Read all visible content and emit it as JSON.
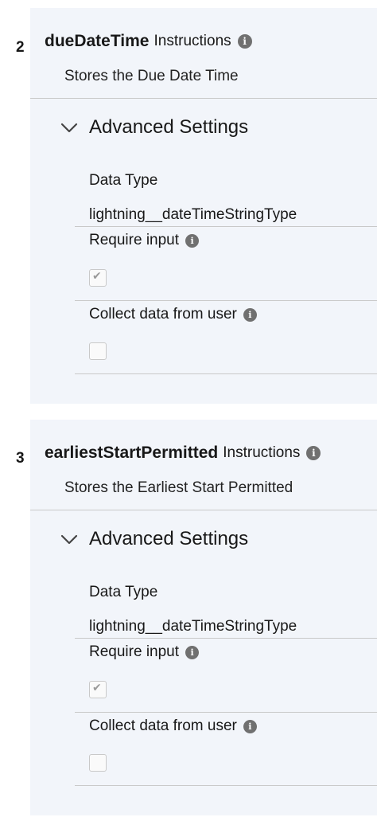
{
  "variables": [
    {
      "number": "2",
      "name": "dueDateTime",
      "instructions_label": "Instructions",
      "description": "Stores the Due Date Time",
      "advanced_label": "Advanced Settings",
      "data_type_label": "Data Type",
      "data_type_value": "lightning__dateTimeStringType",
      "require_input_label": "Require input",
      "require_input_checked": true,
      "collect_label": "Collect data from user",
      "collect_checked": false
    },
    {
      "number": "3",
      "name": "earliestStartPermitted",
      "instructions_label": "Instructions",
      "description": "Stores the Earliest Start Permitted",
      "advanced_label": "Advanced Settings",
      "data_type_label": "Data Type",
      "data_type_value": "lightning__dateTimeStringType",
      "require_input_label": "Require input",
      "require_input_checked": true,
      "collect_label": "Collect data from user",
      "collect_checked": false
    }
  ],
  "icons": {
    "info": "info-icon",
    "chevron": "chevron-down-icon",
    "check": "✔"
  }
}
